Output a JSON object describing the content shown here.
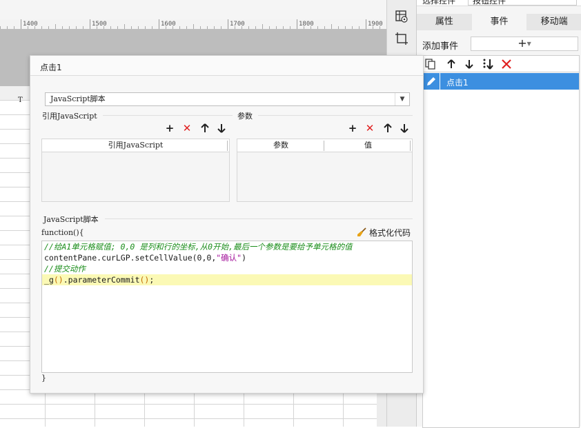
{
  "ruler": {
    "ticks": [
      "1400",
      "1500",
      "1600",
      "1700",
      "1800",
      "1900"
    ]
  },
  "grid": {
    "col_header": "T"
  },
  "right_panel": {
    "select_label": "选择控件",
    "select_value": "按钮控件",
    "tabs": [
      {
        "label": "属性",
        "active": false
      },
      {
        "label": "事件",
        "active": true
      },
      {
        "label": "移动端",
        "active": false
      }
    ],
    "add_event_label": "添加事件",
    "add_event_button": "+",
    "events": [
      {
        "label": "点击1",
        "selected": true
      }
    ]
  },
  "dialog": {
    "title": "点击1",
    "type_value": "JavaScript脚本",
    "ref_section_label": "引用JavaScript",
    "ref_table_header": "引用JavaScript",
    "param_section_label": "参数",
    "param_headers": [
      "参数",
      "值"
    ],
    "script_section_label": "JavaScript脚本",
    "func_open": "function(){",
    "func_close": "}",
    "format_button_label": "格式化代码",
    "code": [
      {
        "kind": "comment",
        "text": "//给A1单元格赋值; 0,0 是列和行的坐标,从0开始,最后一个参数是要给予单元格的值"
      },
      {
        "kind": "mixed",
        "prefix": "contentPane.curLGP.setCellValue(0,0,",
        "string": "\"确认\"",
        "suffix": ")"
      },
      {
        "kind": "comment",
        "text": "//提交动作"
      },
      {
        "kind": "highlight",
        "prefix": "_g",
        "paren": "()",
        "middle": ".parameterCommit",
        "paren2": "()",
        "suffix": ";"
      }
    ]
  },
  "colors": {
    "accent": "#3c8fe0",
    "delete": "#e02020",
    "comment": "#1a8d1a",
    "string": "#a3159b",
    "highlight": "#fbf9b5"
  }
}
